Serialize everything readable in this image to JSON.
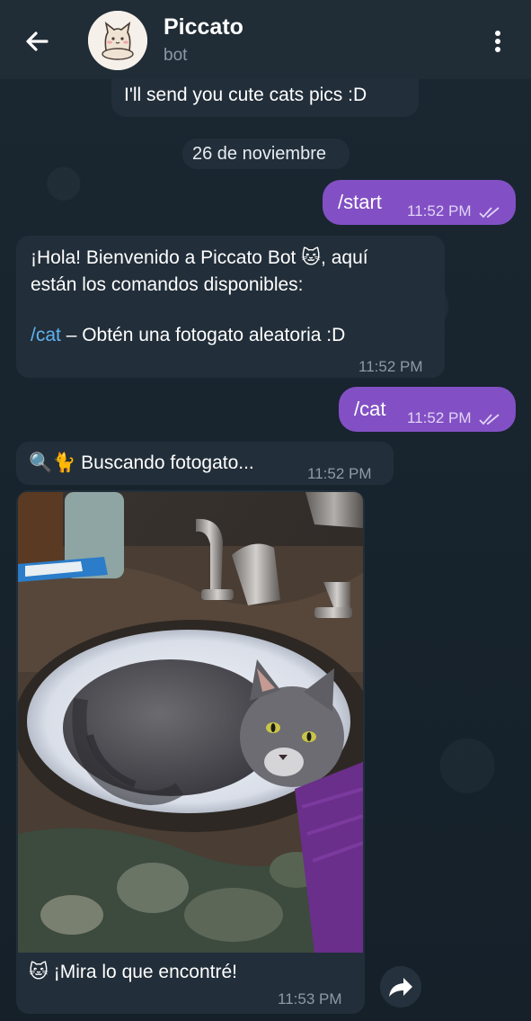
{
  "header": {
    "title": "Piccato",
    "subtitle": "bot"
  },
  "messages": {
    "intro": "I'll send you cute cats pics :D",
    "date": "26 de noviembre",
    "start_cmd": "/start",
    "start_time": "11:52 PM",
    "welcome_line1": "¡Hola! Bienvenido a Piccato Bot 🐱, aquí",
    "welcome_line2": "están los comandos disponibles:",
    "cat_link": "/cat",
    "cat_desc": " – Obtén una fotogato aleatoria :D",
    "welcome_time": "11:52 PM",
    "cat_cmd": "/cat",
    "cat_time": "11:52 PM",
    "searching": "🔍🐈 Buscando fotogato...",
    "searching_time": "11:52 PM",
    "caption": "🐱 ¡Mira lo que encontré!",
    "caption_time": "11:53 PM"
  },
  "colors": {
    "header_bg": "#202c36",
    "bubble_in": "#222e39",
    "bubble_out": "#8250c4",
    "link": "#5fb3ef"
  },
  "icons": [
    "back-arrow-icon",
    "cat-avatar",
    "more-vert-icon",
    "double-check-icon",
    "share-forward-icon"
  ]
}
